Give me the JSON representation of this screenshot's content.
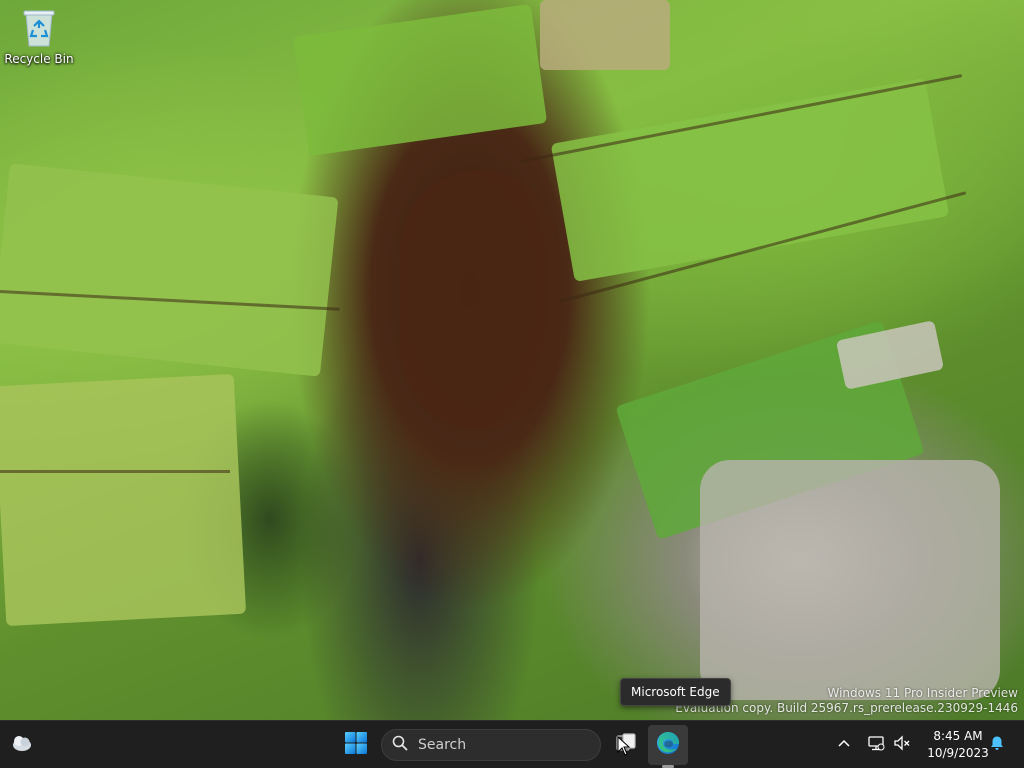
{
  "desktop": {
    "icons": [
      {
        "label": "Recycle Bin",
        "icon": "recycle-bin-icon"
      }
    ],
    "watermark": {
      "line1": "Windows 11 Pro Insider Preview",
      "line2": "Evaluation copy. Build 25967.rs_prerelease.230929-1446"
    }
  },
  "tooltip": {
    "text": "Microsoft Edge"
  },
  "taskbar": {
    "widgets_icon": "weather-widget-icon",
    "start_icon": "windows-start-icon",
    "search_placeholder": "Search",
    "search_icon": "search-icon",
    "task_view_icon": "task-view-icon",
    "edge_icon": "edge-browser-icon",
    "tray": {
      "chevron_icon": "chevron-up-icon",
      "network_icon": "network-icon",
      "volume_icon": "volume-muted-icon",
      "notification_icon": "notification-bell-icon"
    },
    "clock": {
      "time": "8:45 AM",
      "date": "10/9/2023"
    }
  },
  "colors": {
    "taskbar_bg": "#1f1f1f",
    "accent": "#0078d4",
    "bell": "#4cc2ff"
  }
}
